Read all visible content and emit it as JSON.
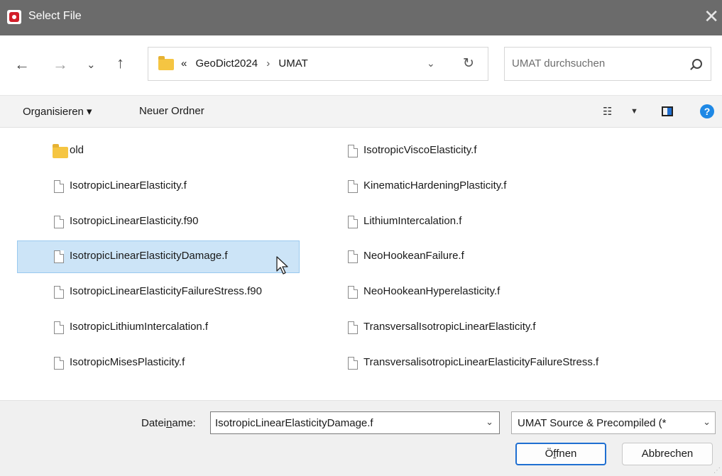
{
  "window": {
    "title": "Select File",
    "close_glyph": "✕"
  },
  "nav": {
    "back_glyph": "←",
    "forward_glyph": "→",
    "recent_glyph": "⌄",
    "up_glyph": "↑"
  },
  "address": {
    "overflow": "«",
    "crumbs": [
      "GeoDict2024",
      "UMAT"
    ],
    "separator": "›",
    "dropdown_glyph": "⌄",
    "refresh_glyph": "↻"
  },
  "search": {
    "placeholder": "UMAT durchsuchen"
  },
  "commandbar": {
    "organize": "Organisieren ▾",
    "new_folder": "Neuer Ordner",
    "view_glyph": "☷",
    "view_arrow": "▼",
    "help": "?"
  },
  "files": [
    {
      "name": "old",
      "type": "folder"
    },
    {
      "name": "IsotropicLinearElasticity.f",
      "type": "file"
    },
    {
      "name": "IsotropicLinearElasticity.f90",
      "type": "file"
    },
    {
      "name": "IsotropicLinearElasticityDamage.f",
      "type": "file",
      "selected": true
    },
    {
      "name": "IsotropicLinearElasticityFailureStress.f90",
      "type": "file"
    },
    {
      "name": "IsotropicLithiumIntercalation.f",
      "type": "file"
    },
    {
      "name": "IsotropicMisesPlasticity.f",
      "type": "file"
    },
    {
      "name": "IsotropicViscoElasticity.f",
      "type": "file"
    },
    {
      "name": "KinematicHardeningPlasticity.f",
      "type": "file"
    },
    {
      "name": "LithiumIntercalation.f",
      "type": "file"
    },
    {
      "name": "NeoHookeanFailure.f",
      "type": "file"
    },
    {
      "name": "NeoHookeanHyperelasticity.f",
      "type": "file"
    },
    {
      "name": "TransversalIsotropicLinearElasticity.f",
      "type": "file"
    },
    {
      "name": "TransversalisotropicLinearElasticityFailureStress.f",
      "type": "file"
    }
  ],
  "bottom": {
    "filename_label_pre": "Datei",
    "filename_label_u": "n",
    "filename_label_post": "ame:",
    "filename_value": "IsotropicLinearElasticityDamage.f",
    "filename_arrow": "⌄",
    "filter_value": "UMAT Source & Precompiled (*",
    "filter_arrow": "⌄",
    "open_pre": "Ö",
    "open_u": "f",
    "open_post": "fnen",
    "cancel": "Abbrechen"
  },
  "colors": {
    "titlebar": "#6b6b6b",
    "selection": "#cce4f7",
    "accent": "#1f6fd1"
  }
}
